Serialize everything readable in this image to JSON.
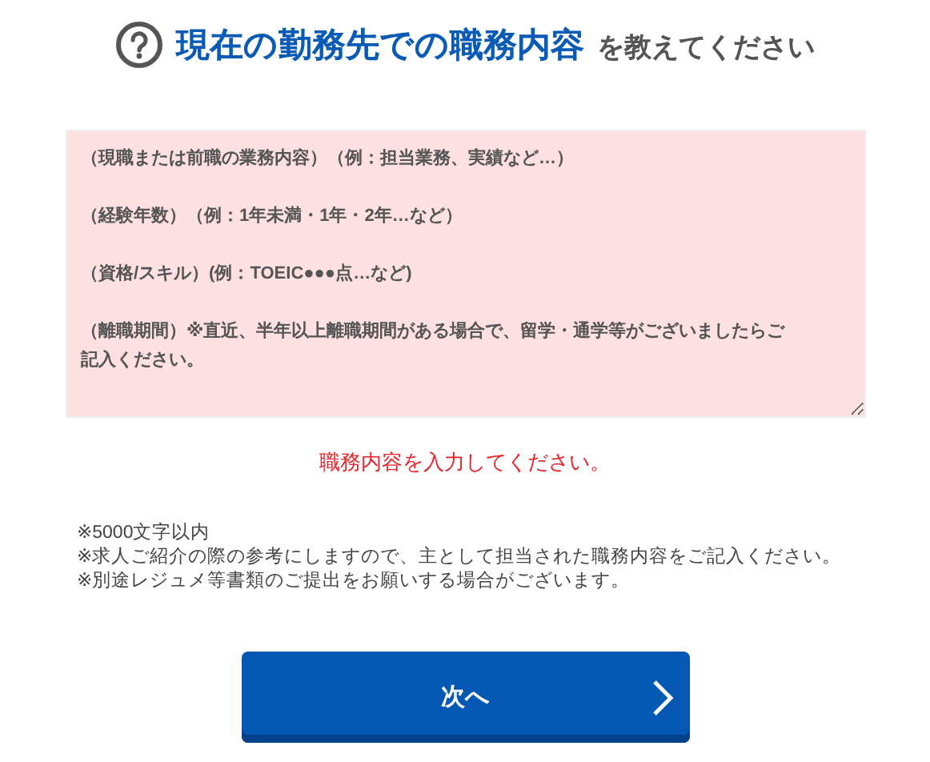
{
  "heading": {
    "highlight": "現在の勤務先での職務内容",
    "rest": "を教えてください"
  },
  "textarea": {
    "placeholder": [
      "（現職または前職の業務内容）（例：担当業務、実績など…）",
      "（経験年数）（例：1年未満・1年・2年…など）",
      "（資格/スキル）(例：TOEIC●●●点…など)",
      "（離職期間）※直近、半年以上離職期間がある場合で、留学・通学等がございましたらご記入ください。"
    ],
    "error": true
  },
  "error_message": "職務内容を入力してください。",
  "notes": [
    "※5000文字以内",
    "※求人ご紹介の際の参考にしますので、主として担当された職務内容をご記入ください。",
    "※別途レジュメ等書類のご提出をお願いする場合がございます。"
  ],
  "next_button": {
    "label": "次へ"
  }
}
